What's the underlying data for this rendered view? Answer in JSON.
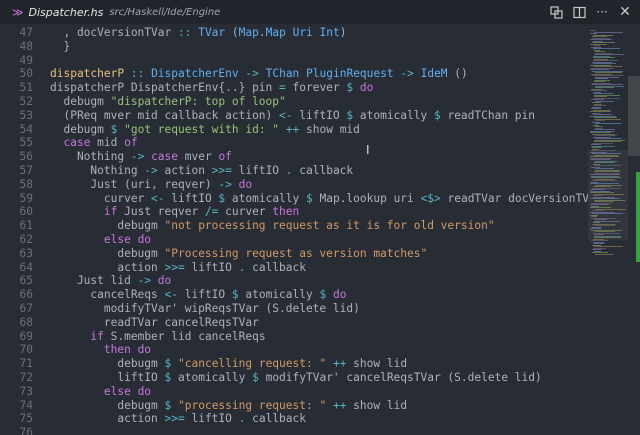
{
  "tab": {
    "file_icon": "haskell-icon",
    "name": "Dispatcher.hs",
    "path": "src/Haskell/Ide/Engine"
  },
  "actions": {
    "open_changes_icon": "compare-icon",
    "split_icon": "split-editor-icon",
    "more_icon": "more-icon",
    "close_icon": "close-icon"
  },
  "code_lines": [
    {
      "n": "47",
      "parts": [
        [
          "fg",
          "  , docVersionTVar "
        ],
        [
          "op",
          ":: "
        ],
        [
          "ty",
          "TVar"
        ],
        [
          "fg",
          " ("
        ],
        [
          "ty",
          "Map"
        ],
        [
          "fg",
          "."
        ],
        [
          "ty",
          "Map"
        ],
        [
          "fg",
          " "
        ],
        [
          "ty",
          "Uri"
        ],
        [
          "fg",
          " "
        ],
        [
          "ty",
          "Int"
        ],
        [
          "fg",
          ")"
        ]
      ]
    },
    {
      "n": "48",
      "parts": [
        [
          "fg",
          "  }"
        ]
      ]
    },
    {
      "n": "49",
      "parts": []
    },
    {
      "n": "50",
      "parts": [
        [
          "def",
          "dispatcherP"
        ],
        [
          "fg",
          " "
        ],
        [
          "op",
          ":: "
        ],
        [
          "ty",
          "DispatcherEnv"
        ],
        [
          "fg",
          " "
        ],
        [
          "op",
          "->"
        ],
        [
          "fg",
          " "
        ],
        [
          "ty",
          "TChan"
        ],
        [
          "fg",
          " "
        ],
        [
          "ty",
          "PluginRequest"
        ],
        [
          "fg",
          " "
        ],
        [
          "op",
          "->"
        ],
        [
          "fg",
          " "
        ],
        [
          "ty",
          "IdeM"
        ],
        [
          "fg",
          " ()"
        ]
      ]
    },
    {
      "n": "51",
      "parts": [
        [
          "fg",
          "dispatcherP DispatcherEnv{..} pin "
        ],
        [
          "op",
          "="
        ],
        [
          "fg",
          " forever "
        ],
        [
          "op",
          "$"
        ],
        [
          "fg",
          " "
        ],
        [
          "kw",
          "do"
        ]
      ]
    },
    {
      "n": "52",
      "parts": [
        [
          "fg",
          "  debugm "
        ],
        [
          "str",
          "\"dispatcherP: top of loop\""
        ]
      ]
    },
    {
      "n": "53",
      "parts": [
        [
          "fg",
          "  (PReq mver mid callback action) "
        ],
        [
          "op",
          "<-"
        ],
        [
          "fg",
          " liftIO "
        ],
        [
          "op",
          "$"
        ],
        [
          "fg",
          " atomically "
        ],
        [
          "op",
          "$"
        ],
        [
          "fg",
          " readTChan pin"
        ]
      ]
    },
    {
      "n": "54",
      "parts": [
        [
          "fg",
          "  debugm "
        ],
        [
          "op",
          "$"
        ],
        [
          "fg",
          " "
        ],
        [
          "str",
          "\"got request with id: \""
        ],
        [
          "fg",
          " "
        ],
        [
          "op",
          "++"
        ],
        [
          "fg",
          " show mid"
        ]
      ]
    },
    {
      "n": "55",
      "parts": [
        [
          "fg",
          "  "
        ],
        [
          "kw",
          "case"
        ],
        [
          "fg",
          " mid "
        ],
        [
          "kw",
          "of"
        ]
      ]
    },
    {
      "n": "56",
      "parts": [
        [
          "fg",
          "    Nothing "
        ],
        [
          "op",
          "->"
        ],
        [
          "fg",
          " "
        ],
        [
          "kw",
          "case"
        ],
        [
          "fg",
          " mver "
        ],
        [
          "kw",
          "of"
        ]
      ]
    },
    {
      "n": "57",
      "parts": [
        [
          "fg",
          "      Nothing "
        ],
        [
          "op",
          "->"
        ],
        [
          "fg",
          " action "
        ],
        [
          "op",
          ">>="
        ],
        [
          "fg",
          " liftIO "
        ],
        [
          "op",
          "."
        ],
        [
          "fg",
          " callback"
        ]
      ]
    },
    {
      "n": "58",
      "parts": [
        [
          "fg",
          "      Just (uri, reqver) "
        ],
        [
          "op",
          "->"
        ],
        [
          "fg",
          " "
        ],
        [
          "kw",
          "do"
        ]
      ]
    },
    {
      "n": "59",
      "parts": [
        [
          "fg",
          "        curver "
        ],
        [
          "op",
          "<-"
        ],
        [
          "fg",
          " liftIO "
        ],
        [
          "op",
          "$"
        ],
        [
          "fg",
          " atomically "
        ],
        [
          "op",
          "$"
        ],
        [
          "fg",
          " Map.lookup uri "
        ],
        [
          "op",
          "<$>"
        ],
        [
          "fg",
          " readTVar docVersionTVar"
        ]
      ]
    },
    {
      "n": "60",
      "parts": [
        [
          "fg",
          "        "
        ],
        [
          "kw",
          "if"
        ],
        [
          "fg",
          " Just reqver "
        ],
        [
          "op",
          "/="
        ],
        [
          "fg",
          " curver "
        ],
        [
          "kw",
          "then"
        ]
      ]
    },
    {
      "n": "61",
      "parts": [
        [
          "fg",
          "          debugm "
        ],
        [
          "str2",
          "\"not processing request as it is for old version\""
        ]
      ]
    },
    {
      "n": "62",
      "parts": [
        [
          "fg",
          "        "
        ],
        [
          "kw",
          "else do"
        ]
      ]
    },
    {
      "n": "63",
      "parts": [
        [
          "fg",
          "          debugm "
        ],
        [
          "str2",
          "\"Processing request as version matches\""
        ]
      ]
    },
    {
      "n": "64",
      "parts": [
        [
          "fg",
          "          action "
        ],
        [
          "op",
          ">>="
        ],
        [
          "fg",
          " liftIO "
        ],
        [
          "op",
          "."
        ],
        [
          "fg",
          " callback"
        ]
      ]
    },
    {
      "n": "65",
      "parts": [
        [
          "fg",
          "    Just lid "
        ],
        [
          "op",
          "->"
        ],
        [
          "fg",
          " "
        ],
        [
          "kw",
          "do"
        ]
      ]
    },
    {
      "n": "66",
      "parts": [
        [
          "fg",
          "      cancelReqs "
        ],
        [
          "op",
          "<-"
        ],
        [
          "fg",
          " liftIO "
        ],
        [
          "op",
          "$"
        ],
        [
          "fg",
          " atomically "
        ],
        [
          "op",
          "$"
        ],
        [
          "fg",
          " "
        ],
        [
          "kw",
          "do"
        ]
      ]
    },
    {
      "n": "67",
      "parts": [
        [
          "fg",
          "        modifyTVar' wipReqsTVar (S.delete lid)"
        ]
      ]
    },
    {
      "n": "68",
      "parts": [
        [
          "fg",
          "        readTVar cancelReqsTVar"
        ]
      ]
    },
    {
      "n": "69",
      "parts": [
        [
          "fg",
          "      "
        ],
        [
          "kw",
          "if"
        ],
        [
          "fg",
          " S.member lid cancelReqs"
        ]
      ]
    },
    {
      "n": "70",
      "parts": [
        [
          "fg",
          "        "
        ],
        [
          "kw",
          "then do"
        ]
      ]
    },
    {
      "n": "71",
      "parts": [
        [
          "fg",
          "          debugm "
        ],
        [
          "op",
          "$"
        ],
        [
          "fg",
          " "
        ],
        [
          "str2",
          "\"cancelling request: \""
        ],
        [
          "fg",
          " "
        ],
        [
          "op",
          "++"
        ],
        [
          "fg",
          " show lid"
        ]
      ]
    },
    {
      "n": "72",
      "parts": [
        [
          "fg",
          "          liftIO "
        ],
        [
          "op",
          "$"
        ],
        [
          "fg",
          " atomically "
        ],
        [
          "op",
          "$"
        ],
        [
          "fg",
          " modifyTVar' cancelReqsTVar (S.delete lid)"
        ]
      ]
    },
    {
      "n": "73",
      "parts": [
        [
          "fg",
          "        "
        ],
        [
          "kw",
          "else do"
        ]
      ]
    },
    {
      "n": "74",
      "parts": [
        [
          "fg",
          "          debugm "
        ],
        [
          "op",
          "$"
        ],
        [
          "fg",
          " "
        ],
        [
          "str2",
          "\"processing request: \""
        ],
        [
          "fg",
          " "
        ],
        [
          "op",
          "++"
        ],
        [
          "fg",
          " show lid"
        ]
      ]
    },
    {
      "n": "75",
      "parts": [
        [
          "fg",
          "          action "
        ],
        [
          "op",
          ">>="
        ],
        [
          "fg",
          " liftIO "
        ],
        [
          "op",
          "."
        ],
        [
          "fg",
          " callback"
        ]
      ]
    },
    {
      "n": "76",
      "parts": []
    }
  ]
}
